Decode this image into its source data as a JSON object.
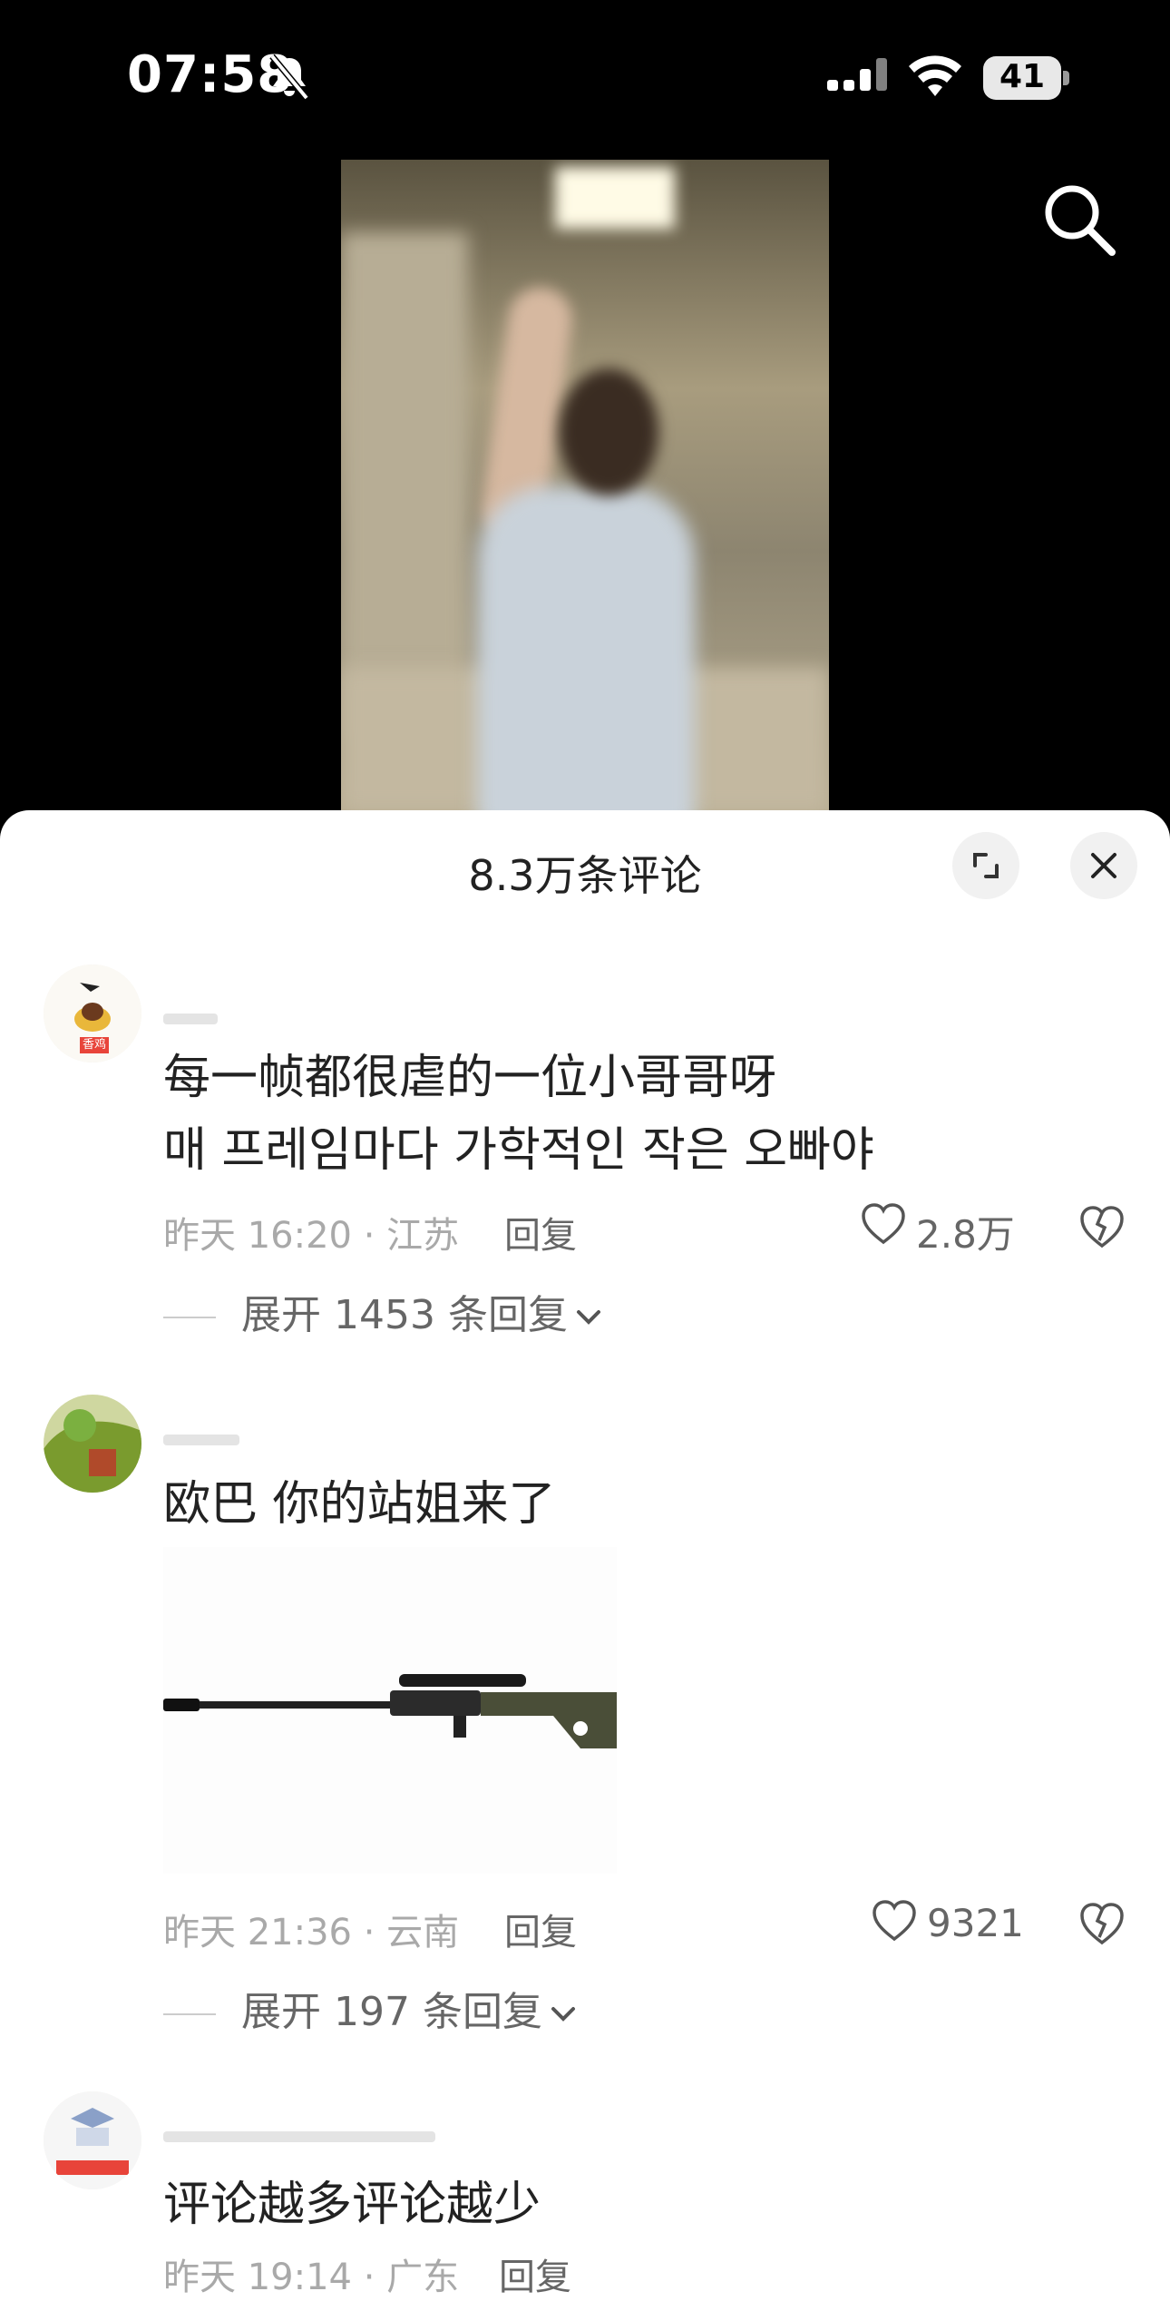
{
  "status_bar": {
    "time": "07:58",
    "battery": "41"
  },
  "sheet": {
    "title": "8.3万条评论"
  },
  "comments": [
    {
      "text_lines": [
        "每一帧都很虐的一位小哥哥呀",
        "매 프레임마다 가학적인 작은 오빠야"
      ],
      "meta": "昨天 16:20 · 江苏",
      "reply_label": "回复",
      "likes": "2.8万",
      "expand_label": "展开 1453 条回复",
      "avatar_badge": "香鸡"
    },
    {
      "text_lines": [
        "欧巴 你的站姐来了"
      ],
      "meta": "昨天 21:36 · 云南",
      "reply_label": "回复",
      "likes": "9321",
      "expand_label": "展开 197 条回复"
    },
    {
      "text_lines": [
        "评论越多评论越少"
      ],
      "meta": "昨天 19:14 · 广东",
      "reply_label": "回复"
    }
  ],
  "colors": {
    "accent_badge": "#e8443a",
    "text_primary": "#222222",
    "text_secondary": "#a9a9a9"
  }
}
